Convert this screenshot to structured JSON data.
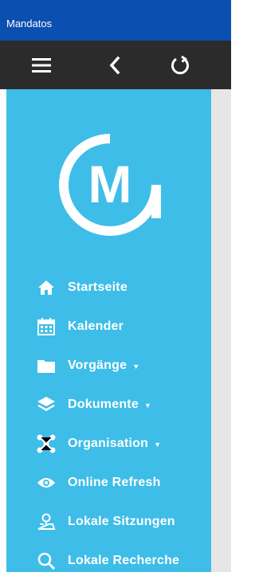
{
  "app": {
    "title": "Mandatos"
  },
  "toolbar": {
    "menu_icon": "hamburger-icon",
    "back_icon": "chevron-left-icon",
    "refresh_icon": "refresh-icon"
  },
  "logo": {
    "letter": "M"
  },
  "colors": {
    "titlebar": "#0b4fb0",
    "toolbar": "#2b2b2b",
    "sidebar": "#3ebde8",
    "content": "#e6e6e6",
    "text": "#ffffff"
  },
  "nav": {
    "items": [
      {
        "label": "Startseite",
        "icon": "home-icon",
        "has_submenu": false
      },
      {
        "label": "Kalender",
        "icon": "calendar-icon",
        "has_submenu": false
      },
      {
        "label": "Vorgänge",
        "icon": "folder-icon",
        "has_submenu": true
      },
      {
        "label": "Dokumente",
        "icon": "layers-icon",
        "has_submenu": true
      },
      {
        "label": "Organisation",
        "icon": "org-chart-icon",
        "has_submenu": true
      },
      {
        "label": "Online Refresh",
        "icon": "eye-icon",
        "has_submenu": false
      },
      {
        "label": "Lokale Sitzungen",
        "icon": "user-location-icon",
        "has_submenu": false
      },
      {
        "label": "Lokale Recherche",
        "icon": "search-icon",
        "has_submenu": false
      }
    ],
    "caret": "▼"
  }
}
